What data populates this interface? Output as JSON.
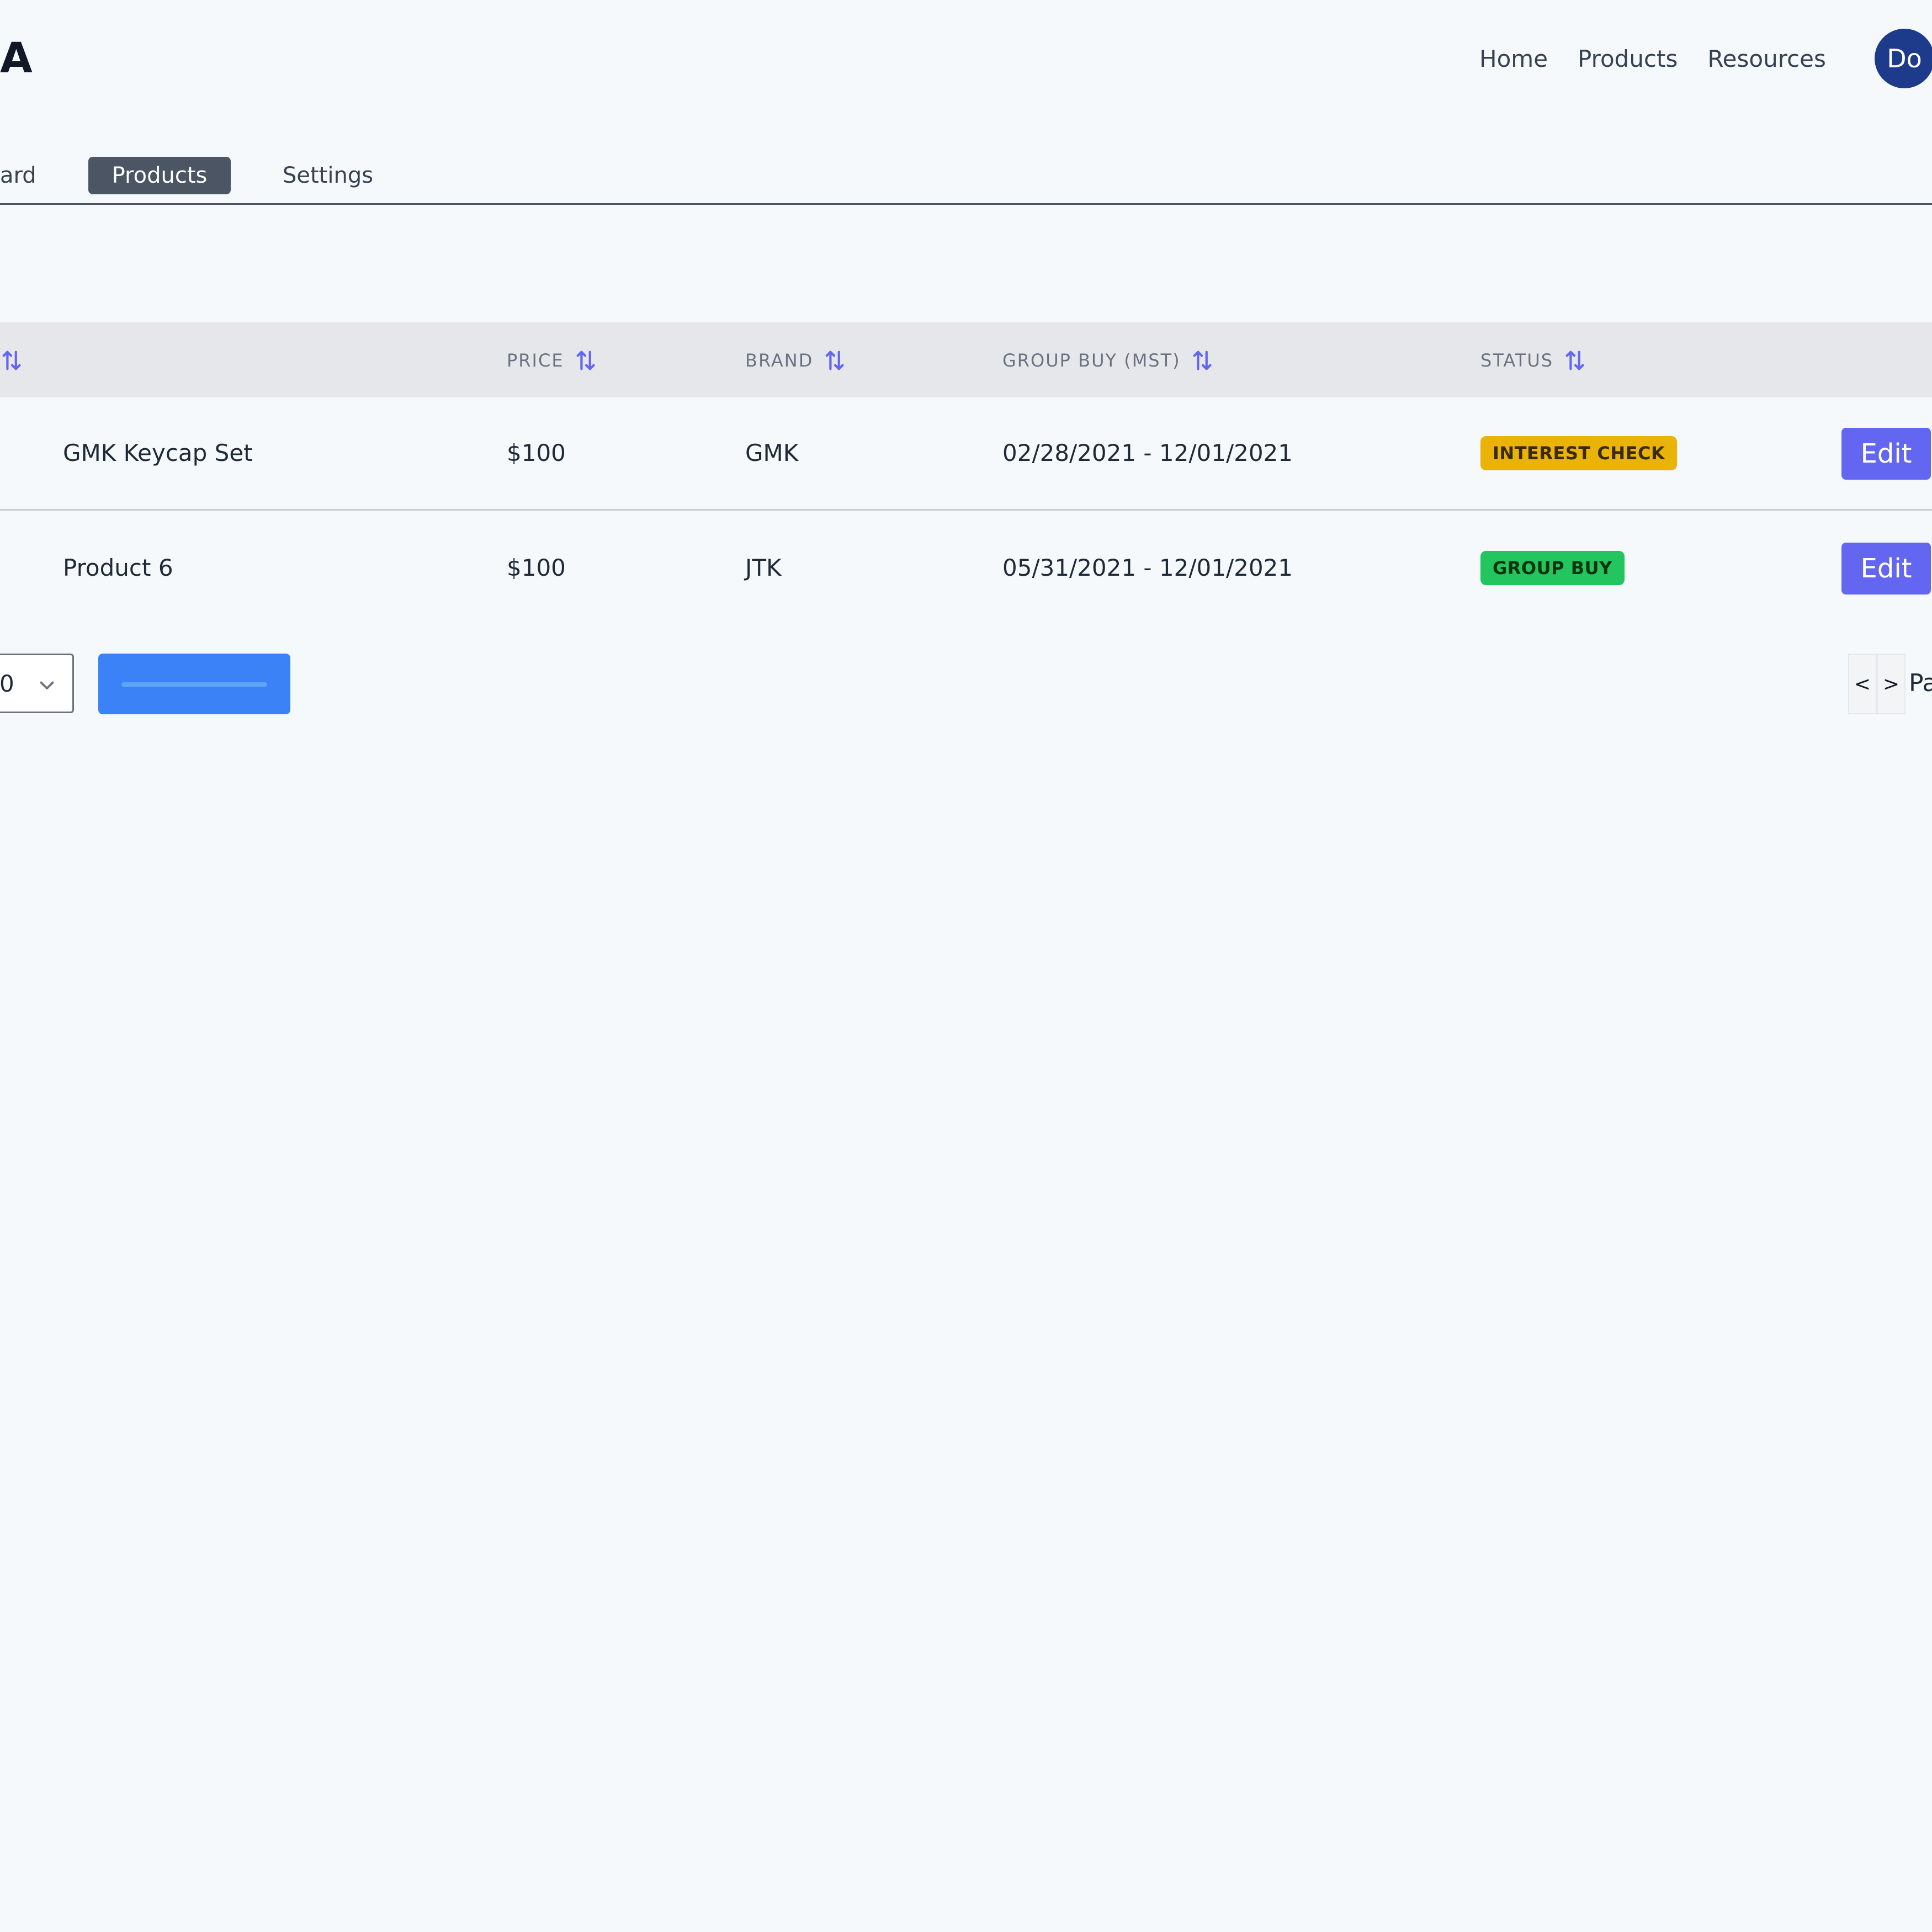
{
  "header": {
    "logo_text": "A",
    "nav": [
      "Home",
      "Products",
      "Resources"
    ],
    "avatar_initials": "Do"
  },
  "tabs": {
    "items": [
      {
        "label": "ard",
        "active": false
      },
      {
        "label": "Products",
        "active": true
      },
      {
        "label": "Settings",
        "active": false
      }
    ]
  },
  "table": {
    "columns": [
      "PRICE",
      "BRAND",
      "GROUP BUY (MST)",
      "STATUS"
    ],
    "rows": [
      {
        "name": "GMK Keycap Set",
        "price": "$100",
        "brand": "GMK",
        "group_buy": "02/28/2021 - 12/01/2021",
        "status": "INTEREST CHECK",
        "action": "Edit"
      },
      {
        "name": "Product 6",
        "price": "$100",
        "brand": "JTK",
        "group_buy": "05/31/2021 - 12/01/2021",
        "status": "GROUP BUY",
        "action": "Edit"
      }
    ]
  },
  "footer": {
    "page_size_value": "0",
    "prev_label": "<",
    "next_label": ">",
    "page_label": "Pa"
  },
  "colors": {
    "background": "#f5f9fc",
    "accent": "#6366f1",
    "primary_button": "#3b82f6",
    "interest_check": "#eab308",
    "group_buy": "#22c55e",
    "avatar": "#1e3a8a"
  }
}
